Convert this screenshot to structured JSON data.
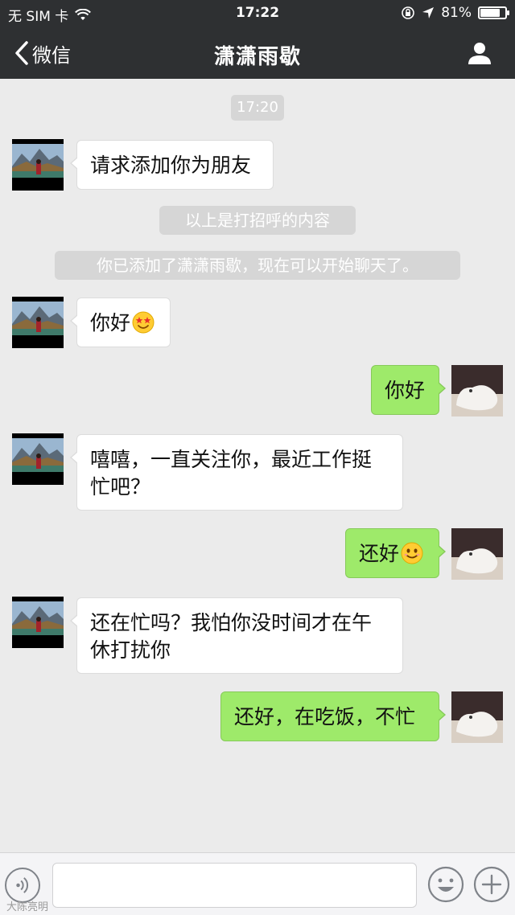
{
  "status_bar": {
    "carrier": "无 SIM 卡",
    "time": "17:22",
    "battery": "81%",
    "battery_level": 0.81
  },
  "nav": {
    "back_label": "微信",
    "title": "潇潇雨歇"
  },
  "chat": {
    "timestamp": "17:20",
    "system_messages": [
      "以上是打招呼的内容",
      "你已添加了潇潇雨歇，现在可以开始聊天了。"
    ],
    "messages": [
      {
        "side": "in",
        "text": "请求添加你为朋友"
      },
      {
        "side": "in",
        "text": "你好",
        "emoji": "star-eyes-emoji"
      },
      {
        "side": "out",
        "text": "你好"
      },
      {
        "side": "in",
        "lines": [
          "嘻嘻，一直关注你，最近工作挺",
          "忙吧？"
        ]
      },
      {
        "side": "out",
        "text": "还好",
        "emoji": "smile-emoji"
      },
      {
        "side": "in",
        "lines": [
          "还在忙吗？我怕你没时间才在午",
          "休打扰你"
        ]
      },
      {
        "side": "out",
        "text": "还好，在吃饭，不忙"
      }
    ]
  },
  "input_bar": {
    "voice_icon": "voice-icon",
    "emoji_icon": "smiley-icon",
    "plus_icon": "plus-icon"
  },
  "watermark": "大陈亮明",
  "colors": {
    "nav_bg": "#2e3032",
    "chat_bg": "#ebebeb",
    "out_bubble": "#9eea6a",
    "in_bubble": "#ffffff"
  }
}
